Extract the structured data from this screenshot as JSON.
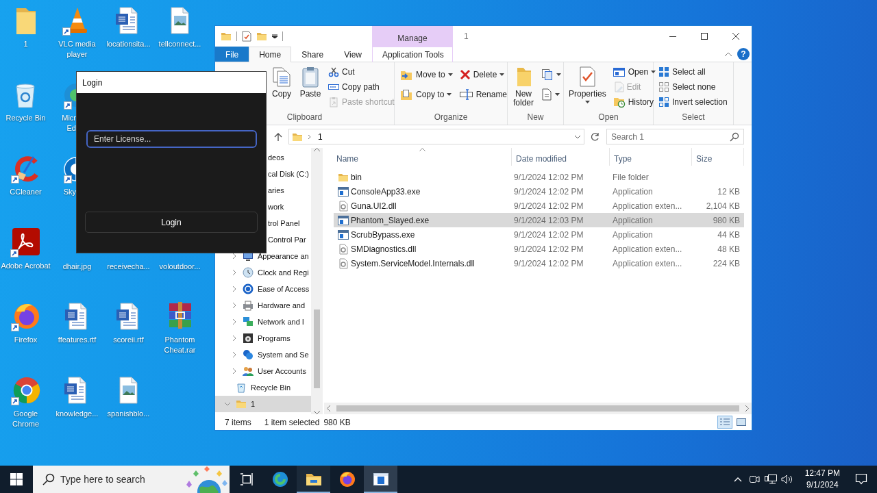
{
  "desktop": {
    "rows": [
      [
        {
          "label": "1",
          "kind": "folder"
        },
        {
          "label": "VLC media player",
          "kind": "vlc",
          "shortcut": true
        },
        {
          "label": "locationsita...",
          "kind": "word"
        },
        {
          "label": "tellconnect...",
          "kind": "image"
        }
      ],
      [
        {
          "label": "Recycle Bin",
          "kind": "recycle"
        },
        {
          "label": "Micr\nEd",
          "kind": "edge",
          "shortcut": true
        }
      ],
      [
        {
          "label": "CCleaner",
          "kind": "ccleaner",
          "shortcut": true
        },
        {
          "label": "Sky",
          "kind": "skype",
          "shortcut": true
        }
      ],
      [
        {
          "label": "Adobe Acrobat",
          "kind": "acrobat",
          "shortcut": true
        },
        {
          "label": "dhair.jpg",
          "kind": "covered"
        },
        {
          "label": "receivecha...",
          "kind": "covered"
        },
        {
          "label": "voloutdoor...",
          "kind": "covered"
        }
      ],
      [
        {
          "label": "Firefox",
          "kind": "firefox",
          "shortcut": true
        },
        {
          "label": "ffeatures.rtf",
          "kind": "word"
        },
        {
          "label": "scoreii.rtf",
          "kind": "word"
        },
        {
          "label": "Phantom Cheat.rar",
          "kind": "winrar"
        }
      ],
      [
        {
          "label": "Google Chrome",
          "kind": "chrome",
          "shortcut": true
        },
        {
          "label": "knowledge...",
          "kind": "word"
        },
        {
          "label": "spanishblo...",
          "kind": "image"
        }
      ]
    ]
  },
  "explorer": {
    "title": "1",
    "contextual_header": "Manage",
    "help": "?",
    "ribbon_tabs": [
      {
        "label": "File",
        "kind": "file",
        "selected": false
      },
      {
        "label": "Home",
        "kind": "tab",
        "selected": true
      },
      {
        "label": "Share",
        "kind": "tab",
        "selected": false
      },
      {
        "label": "View",
        "kind": "tab",
        "selected": false
      },
      {
        "label": "Application Tools",
        "kind": "contextual",
        "selected": false
      }
    ],
    "ribbon_groups": [
      {
        "label": "Clipboard",
        "columns": [
          [
            {
              "label": "Copy",
              "kind": "copy",
              "disabled": false,
              "dropdown": false
            }
          ],
          [
            {
              "label": "Paste",
              "kind": "paste",
              "disabled": false,
              "dropdown": false
            }
          ],
          [
            {
              "label": "Cut",
              "kind": "cut",
              "disabled": false,
              "dropdown": false
            },
            {
              "label": "Copy path",
              "kind": "copy-path",
              "disabled": false,
              "dropdown": false
            },
            {
              "label": "Paste shortcut",
              "kind": "paste-shortcut",
              "disabled": true,
              "dropdown": false
            }
          ]
        ]
      },
      {
        "label": "Organize",
        "columns": [
          [
            {
              "label": "Move to",
              "kind": "move-to",
              "disabled": false,
              "dropdown": true
            },
            {
              "label": "Copy to",
              "kind": "copy-to",
              "disabled": false,
              "dropdown": true
            }
          ],
          [
            {
              "label": "Delete",
              "kind": "delete",
              "disabled": false,
              "dropdown": true
            },
            {
              "label": "Rename",
              "kind": "rename",
              "disabled": false,
              "dropdown": false
            }
          ]
        ]
      },
      {
        "label": "New",
        "columns": [
          [
            {
              "label": "New\nfolder",
              "kind": "new-folder",
              "disabled": false,
              "dropdown": false
            }
          ],
          [
            {
              "kind": "new-item",
              "disabled": false,
              "dropdown": true
            },
            {
              "kind": "easy-access",
              "disabled": false,
              "dropdown": true
            }
          ]
        ]
      },
      {
        "label": "Open",
        "columns": [
          [
            {
              "label": "Properties",
              "kind": "properties",
              "disabled": false,
              "dropdown": true
            }
          ],
          [
            {
              "label": "Open",
              "kind": "open",
              "disabled": false,
              "dropdown": true
            },
            {
              "label": "Edit",
              "kind": "edit",
              "disabled": true,
              "dropdown": false
            },
            {
              "label": "History",
              "kind": "history",
              "disabled": false,
              "dropdown": false
            }
          ]
        ]
      },
      {
        "label": "Select",
        "columns": [
          [
            {
              "label": "Select all",
              "kind": "select-all",
              "disabled": false,
              "dropdown": false
            },
            {
              "label": "Select none",
              "kind": "select-none",
              "disabled": false,
              "dropdown": false
            },
            {
              "label": "Invert selection",
              "kind": "invert",
              "disabled": false,
              "dropdown": false
            }
          ]
        ]
      }
    ],
    "address": {
      "crumbs": [
        "1"
      ]
    },
    "search": {
      "placeholder": "Search 1"
    },
    "nav_pane": {
      "items": [
        {
          "label": "deos",
          "kind": "cut",
          "selected": false
        },
        {
          "label": "cal Disk (C:)",
          "kind": "cut",
          "selected": false
        },
        {
          "label": "aries",
          "kind": "cut",
          "selected": false
        },
        {
          "label": "work",
          "kind": "cut",
          "selected": false
        },
        {
          "label": "trol Panel",
          "kind": "cut",
          "selected": false,
          "children": [
            {
              "label": "Control Par",
              "kind": "cut",
              "selected": false
            },
            {
              "label": "Appearance an",
              "kind": "appearance",
              "expanded": false,
              "selected": false
            },
            {
              "label": "Clock and Regi",
              "kind": "clock",
              "expanded": false,
              "selected": false
            },
            {
              "label": "Ease of Access",
              "kind": "access",
              "expanded": false,
              "selected": false
            },
            {
              "label": "Hardware and",
              "kind": "hardware",
              "expanded": false,
              "selected": false
            },
            {
              "label": "Network and I",
              "kind": "network",
              "expanded": false,
              "selected": false
            },
            {
              "label": "Programs",
              "kind": "programs",
              "expanded": false,
              "selected": false
            },
            {
              "label": "System and Se",
              "kind": "security",
              "expanded": false,
              "selected": false
            },
            {
              "label": "User Accounts",
              "kind": "users",
              "expanded": false,
              "selected": false
            }
          ]
        },
        {
          "label": "Recycle Bin",
          "kind": "recycle",
          "selected": false
        },
        {
          "label": "1",
          "kind": "folder",
          "expanded": true,
          "selected": true
        }
      ]
    },
    "columns": [
      {
        "label": "Name",
        "sorted": true
      },
      {
        "label": "Date modified",
        "sorted": false
      },
      {
        "label": "Type",
        "sorted": false
      },
      {
        "label": "Size",
        "sorted": false
      }
    ],
    "rows": [
      {
        "name": "bin",
        "kind": "folder",
        "date": "9/1/2024 12:02 PM",
        "type": "File folder",
        "selected": false
      },
      {
        "name": "ConsoleApp33.exe",
        "kind": "exe",
        "date": "9/1/2024 12:02 PM",
        "type": "Application",
        "size": "12 KB",
        "selected": false
      },
      {
        "name": "Guna.UI2.dll",
        "kind": "dll",
        "date": "9/1/2024 12:02 PM",
        "type": "Application exten...",
        "size": "2,104 KB",
        "selected": false
      },
      {
        "name": "Phantom_Slayed.exe",
        "kind": "exe",
        "date": "9/1/2024 12:03 PM",
        "type": "Application",
        "size": "980 KB",
        "selected": true
      },
      {
        "name": "ScrubBypass.exe",
        "kind": "exe",
        "date": "9/1/2024 12:02 PM",
        "type": "Application",
        "size": "44 KB",
        "selected": false
      },
      {
        "name": "SMDiagnostics.dll",
        "kind": "dll",
        "date": "9/1/2024 12:02 PM",
        "type": "Application exten...",
        "size": "48 KB",
        "selected": false
      },
      {
        "name": "System.ServiceModel.Internals.dll",
        "kind": "dll",
        "date": "9/1/2024 12:02 PM",
        "type": "Application exten...",
        "size": "224 KB",
        "selected": false
      }
    ],
    "status_bar": {
      "count": "7 items",
      "selection": "1 item selected",
      "size": "980 KB"
    },
    "view_buttons": [
      {
        "kind": "details",
        "selected": true
      },
      {
        "kind": "large-icons",
        "selected": false
      }
    ]
  },
  "login_window": {
    "title": "Login",
    "license_field": {
      "placeholder": "Enter License...",
      "focused": true
    },
    "login_button": "Login"
  },
  "taskbar": {
    "search_placeholder": "Type here to search",
    "apps": [
      {
        "kind": "task-view",
        "open": false,
        "selected": false
      },
      {
        "kind": "edge",
        "open": false,
        "selected": false
      },
      {
        "kind": "explorer",
        "open": true,
        "selected": false
      },
      {
        "kind": "firefox",
        "open": false,
        "selected": false
      },
      {
        "kind": "app",
        "open": true,
        "selected": true
      }
    ],
    "time": "12:47 PM",
    "date": "9/1/2024"
  }
}
